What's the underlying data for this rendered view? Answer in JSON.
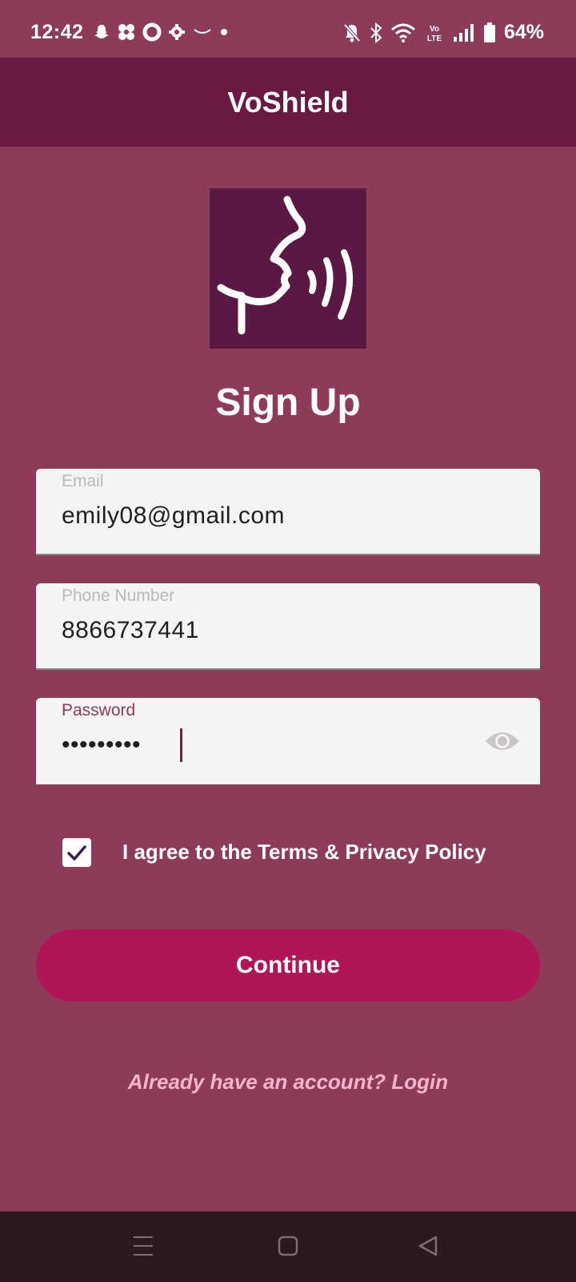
{
  "status_bar": {
    "time": "12:42",
    "battery": "64%",
    "left_icons": [
      "snapchat-icon",
      "pinwheel-icon",
      "ring-icon",
      "gear-icon",
      "smile-icon",
      "dot-icon"
    ],
    "right_icons": [
      "bell-off-icon",
      "bluetooth-icon",
      "wifi-icon",
      "volte-icon",
      "signal-icon",
      "battery-icon"
    ]
  },
  "app_bar": {
    "title": "VoShield"
  },
  "logo": {
    "icon": "speaking-head-icon"
  },
  "heading": "Sign Up",
  "form": {
    "email": {
      "label": "Email",
      "value": "emily08@gmail.com"
    },
    "phone": {
      "label": "Phone Number",
      "value": "8866737441"
    },
    "password": {
      "label": "Password",
      "value": "•••••••••",
      "visibility_icon": "eye-icon"
    },
    "terms": {
      "checked": true,
      "label": "I agree to the Terms & Privacy Policy"
    }
  },
  "continue_label": "Continue",
  "login_link": "Already have an account? Login",
  "colors": {
    "background": "#8e3b59",
    "app_bar": "#6a1a40",
    "button": "#b01556",
    "link": "#f5b6cd",
    "logo_bg": "#591942"
  },
  "nav_bar": {
    "icons": [
      "menu-icon",
      "home-square-icon",
      "back-triangle-icon"
    ]
  }
}
